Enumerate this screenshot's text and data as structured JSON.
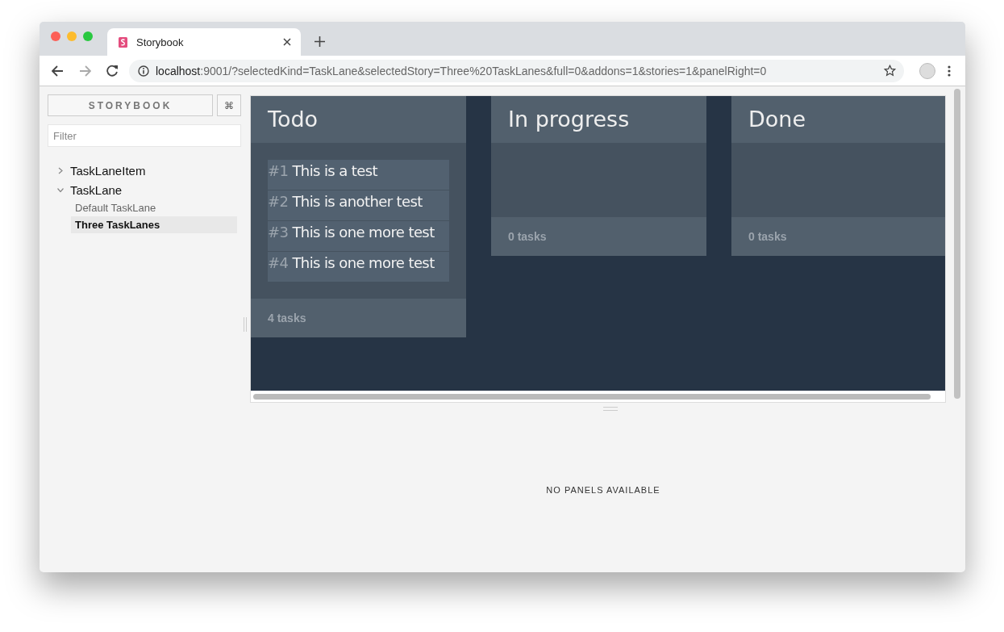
{
  "browser": {
    "tab_title": "Storybook",
    "url_host": "localhost",
    "url_rest": ":9001/?selectedKind=TaskLane&selectedStory=Three%20TaskLanes&full=0&addons=1&stories=1&panelRight=0"
  },
  "sidebar": {
    "brand": "STORYBOOK",
    "shortcut": "⌘",
    "filter_placeholder": "Filter",
    "tree": [
      {
        "label": "TaskLaneItem",
        "expanded": false
      },
      {
        "label": "TaskLane",
        "expanded": true,
        "children": [
          {
            "label": "Default TaskLane",
            "selected": false
          },
          {
            "label": "Three TaskLanes",
            "selected": true
          }
        ]
      }
    ]
  },
  "lanes": [
    {
      "title": "Todo",
      "tasks": [
        {
          "number": "#1",
          "title": "This is a test"
        },
        {
          "number": "#2",
          "title": "This is another test"
        },
        {
          "number": "#3",
          "title": "This is one more test"
        },
        {
          "number": "#4",
          "title": "This is one more test"
        }
      ],
      "footer": "4 tasks"
    },
    {
      "title": "In progress",
      "footer": "0 tasks"
    },
    {
      "title": "Done",
      "footer": "0 tasks"
    }
  ],
  "addon_panel": {
    "message": "NO PANELS AVAILABLE"
  }
}
